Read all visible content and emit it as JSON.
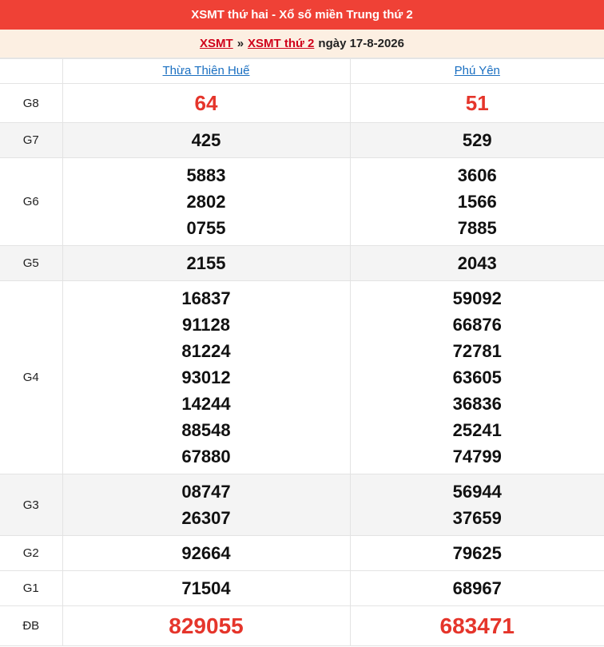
{
  "header": {
    "title": "XSMT thứ hai - Xổ số miền Trung thứ 2"
  },
  "breadcrumb": {
    "link1": "XSMT",
    "separator": "»",
    "link2": "XSMT thứ 2",
    "date_text": "ngày 17-8-2026"
  },
  "provinces": [
    "Thừa Thiên Huế",
    "Phú Yên"
  ],
  "prizes": [
    {
      "label": "G8",
      "a": [
        "64"
      ],
      "b": [
        "51"
      ]
    },
    {
      "label": "G7",
      "a": [
        "425"
      ],
      "b": [
        "529"
      ]
    },
    {
      "label": "G6",
      "a": [
        "5883",
        "2802",
        "0755"
      ],
      "b": [
        "3606",
        "1566",
        "7885"
      ]
    },
    {
      "label": "G5",
      "a": [
        "2155"
      ],
      "b": [
        "2043"
      ]
    },
    {
      "label": "G4",
      "a": [
        "16837",
        "91128",
        "81224",
        "93012",
        "14244",
        "88548",
        "67880"
      ],
      "b": [
        "59092",
        "66876",
        "72781",
        "63605",
        "36836",
        "25241",
        "74799"
      ]
    },
    {
      "label": "G3",
      "a": [
        "08747",
        "26307"
      ],
      "b": [
        "56944",
        "37659"
      ]
    },
    {
      "label": "G2",
      "a": [
        "92664"
      ],
      "b": [
        "79625"
      ]
    },
    {
      "label": "G1",
      "a": [
        "71504"
      ],
      "b": [
        "68967"
      ]
    },
    {
      "label": "ĐB",
      "a": [
        "829055"
      ],
      "b": [
        "683471"
      ]
    }
  ],
  "colors": {
    "header_bg": "#ef4136",
    "highlight_number": "#e5352b",
    "province_link": "#1a6fc1",
    "breadcrumb_link": "#d0021b"
  }
}
